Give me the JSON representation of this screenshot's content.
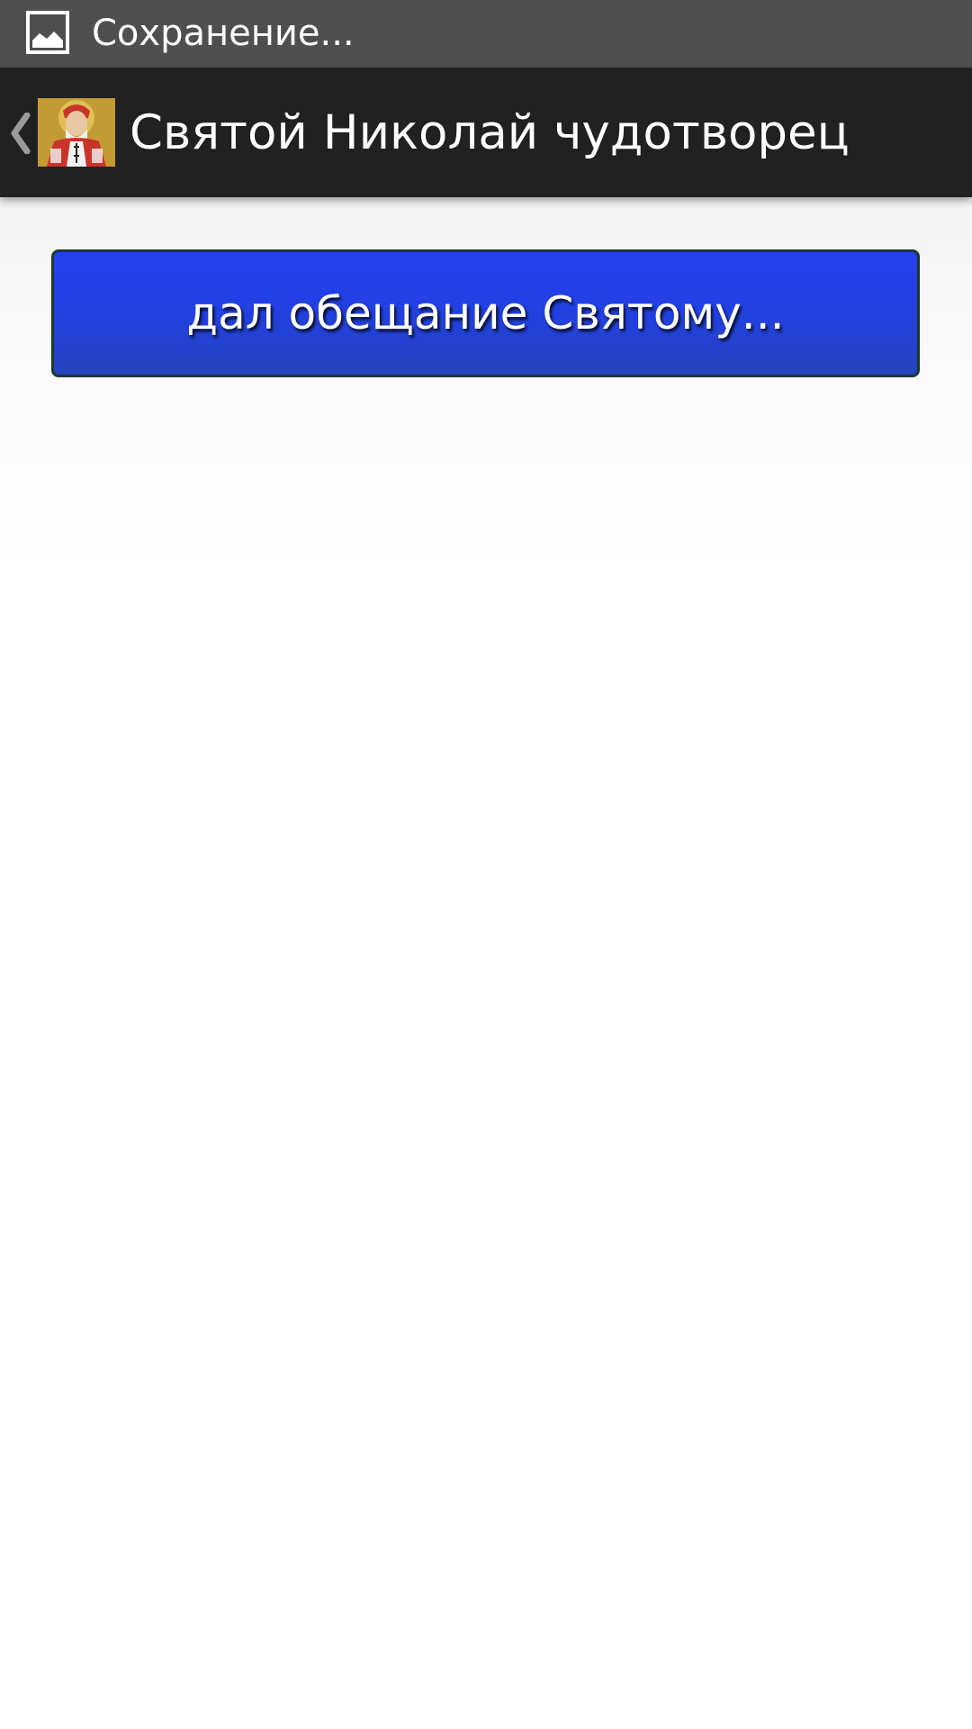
{
  "status_bar": {
    "icon": "image-icon",
    "text": "Сохранение..."
  },
  "action_bar": {
    "back_icon": "chevron-left-icon",
    "app_icon": "saint-nicholas-icon",
    "title": "Святой Николай чудотворец"
  },
  "content": {
    "button_label": "дал обещание Святому..."
  },
  "colors": {
    "status_bar_bg": "#4f4f4f",
    "action_bar_bg": "#212121",
    "button_blue": "#2240e4",
    "text_white": "#ffffff"
  }
}
